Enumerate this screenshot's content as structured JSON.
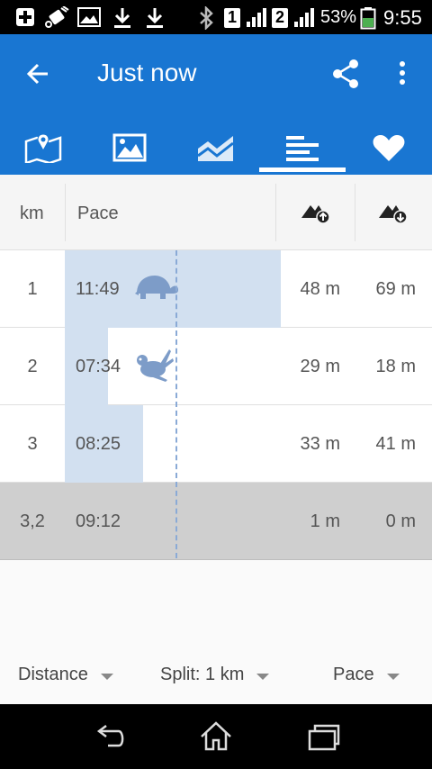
{
  "status_bar": {
    "sim1": "1",
    "sim2": "2",
    "battery": "53%",
    "time": "9:55",
    "icons": [
      "add-box-icon",
      "gps-off-icon",
      "image-icon",
      "download-icon",
      "download-icon",
      "bluetooth-icon",
      "signal-icon",
      "battery-icon"
    ]
  },
  "app_bar": {
    "title": "Just now",
    "back_icon": "arrow-back-icon",
    "share_icon": "share-icon",
    "more_icon": "more-vert-icon"
  },
  "tabs": [
    {
      "icon": "map-icon",
      "selected": false
    },
    {
      "icon": "photo-icon",
      "selected": false
    },
    {
      "icon": "chart-icon",
      "selected": false
    },
    {
      "icon": "splits-icon",
      "selected": true
    },
    {
      "icon": "heart-icon",
      "selected": false
    }
  ],
  "table": {
    "headers": {
      "km": "km",
      "pace": "Pace",
      "ascent_icon": "ascent-icon",
      "descent_icon": "descent-icon"
    },
    "rows": [
      {
        "km": "1",
        "pace": "11:49",
        "up": "48 m",
        "down": "69 m",
        "pace_fraction": 1.0,
        "badge": "turtle-icon"
      },
      {
        "km": "2",
        "pace": "07:34",
        "up": "29 m",
        "down": "18 m",
        "pace_fraction": 0.2,
        "badge": "rabbit-icon"
      },
      {
        "km": "3",
        "pace": "08:25",
        "up": "33 m",
        "down": "41 m",
        "pace_fraction": 0.364,
        "badge": ""
      }
    ],
    "total": {
      "km": "3,2",
      "pace": "09:12",
      "up": "1 m",
      "down": "0 m"
    }
  },
  "footer": {
    "distance": "Distance",
    "split": "Split: 1 km",
    "pace": "Pace"
  },
  "colors": {
    "accent": "#1976d2",
    "pace_bar": "#d2e0f0",
    "icon_blue": "#7d9cc8",
    "total_row": "#cfcfcf"
  }
}
